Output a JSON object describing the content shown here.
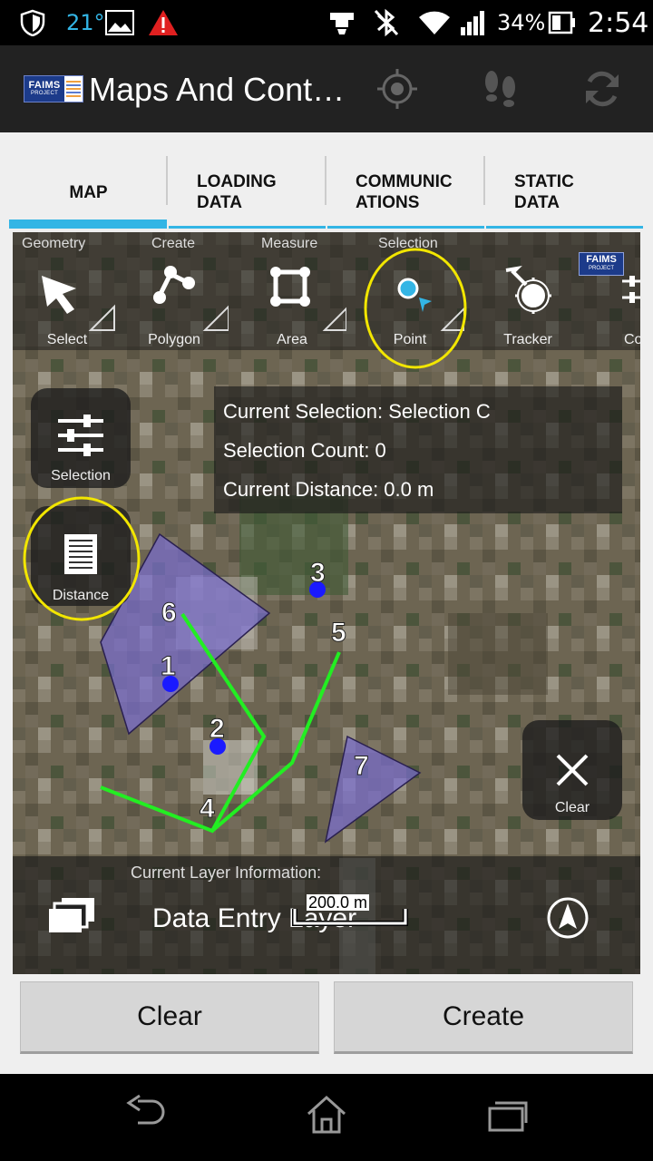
{
  "status_bar": {
    "temperature": "21°",
    "battery_percent": "34%",
    "time": "2:54"
  },
  "app_bar": {
    "logo_text": "FAIMS",
    "logo_subtext": "PROJECT",
    "title": "Maps And Cont…",
    "icons": [
      "gps-target-icon",
      "footsteps-icon",
      "sync-icon"
    ]
  },
  "tabs": [
    {
      "label": "MAP",
      "active": true
    },
    {
      "label": "LOADING\nDATA",
      "active": false
    },
    {
      "label": "COMMUNIC\nATIONS",
      "active": false
    },
    {
      "label": "STATIC\nDATA",
      "active": false
    }
  ],
  "toolbar": {
    "group_labels": [
      "Geometry",
      "Create",
      "Measure",
      "Selection"
    ],
    "tools": [
      {
        "label": "Select",
        "icon": "arrow-pointer-icon"
      },
      {
        "label": "Polygon",
        "icon": "polygon-icon"
      },
      {
        "label": "Area",
        "icon": "area-square-icon"
      },
      {
        "label": "Point",
        "icon": "point-selection-icon",
        "highlighted": true
      },
      {
        "label": "Tracker",
        "icon": "tracker-icon"
      },
      {
        "label": "Co",
        "icon": "sliders-icon"
      }
    ],
    "badge_text": "FAIMS",
    "badge_subtext": "PROJECT"
  },
  "info_panel": {
    "current_selection": "Current Selection: Selection C",
    "selection_count": "Selection Count: 0",
    "current_distance": "Current Distance: 0.0 m"
  },
  "side_buttons": {
    "selection_label": "Selection",
    "distance_label": "Distance",
    "clear_label": "Clear"
  },
  "map_markers": [
    "1",
    "2",
    "3",
    "4",
    "5",
    "6",
    "7"
  ],
  "layer_bar": {
    "heading": "Current Layer Information:",
    "layer_name": "Data Entry Layer",
    "scale": "200.0 m"
  },
  "buttons": {
    "clear": "Clear",
    "create": "Create"
  },
  "colors": {
    "accent": "#33b5e5",
    "highlight_circle": "#f2e600",
    "line_green": "#22ee22",
    "polygon_fill": "#7b6fd6",
    "point_blue": "#1a1aff"
  }
}
